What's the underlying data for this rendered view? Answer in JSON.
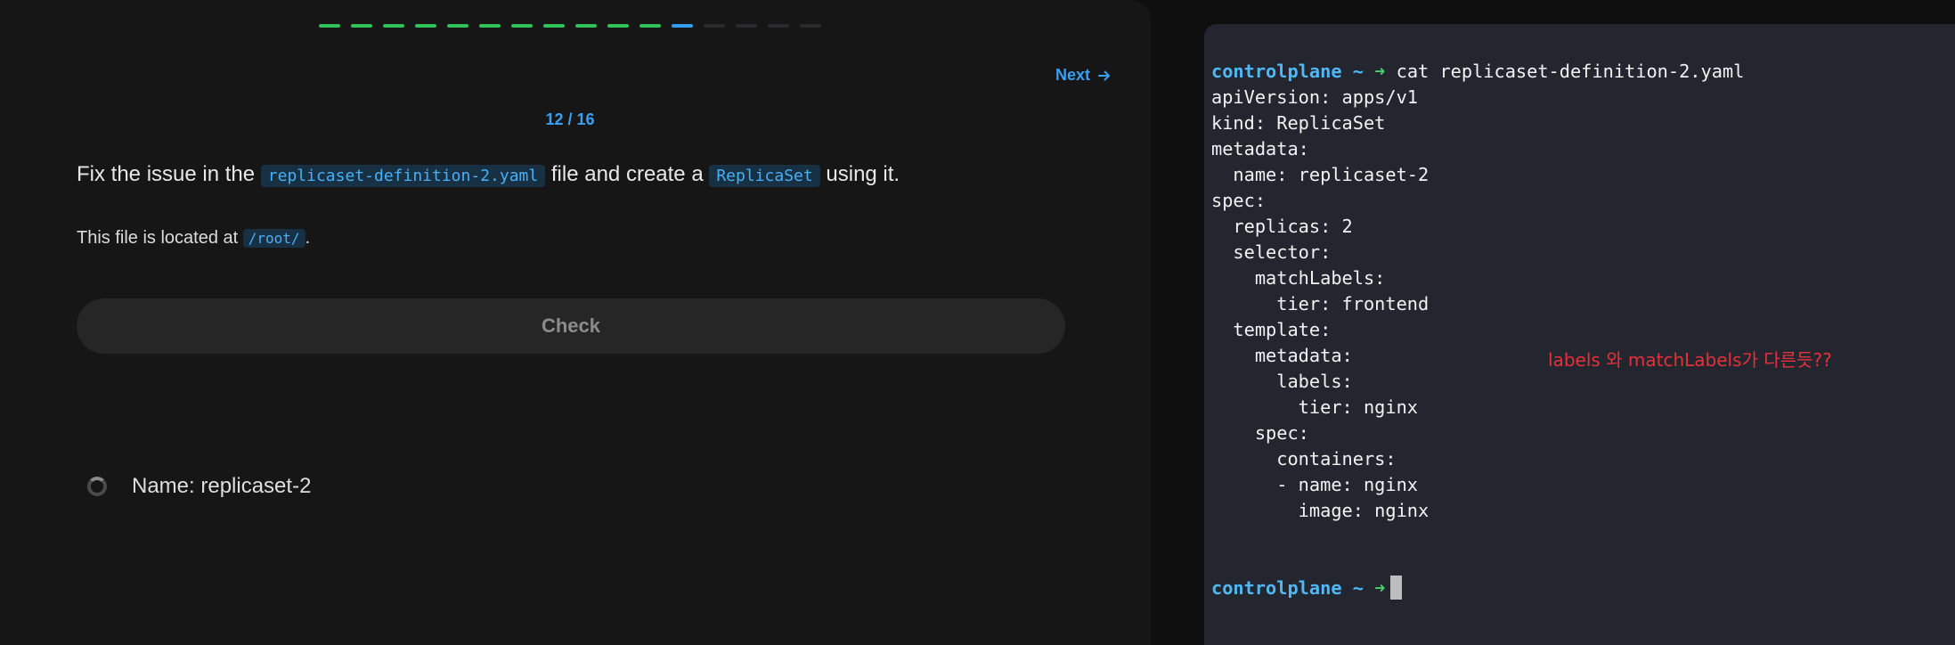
{
  "progress": {
    "total": 16,
    "current": 12,
    "colors": {
      "done": "#2fc259",
      "current": "#2f9ef0",
      "todo": "#2a2a2c"
    }
  },
  "nav": {
    "next_label": "Next",
    "next_icon": "arrow-right-icon"
  },
  "counter": "12 / 16",
  "task": {
    "prefix": "Fix the issue in the",
    "file": "replicaset-definition-2.yaml",
    "middle": "file and create a",
    "resource": "ReplicaSet",
    "suffix": "using it."
  },
  "note": {
    "prefix": "This file is located at",
    "path": "/root/",
    "suffix": "."
  },
  "check_label": "Check",
  "result_item": {
    "label": "Name: replicaset-2",
    "status_icon": "spinner-icon"
  },
  "terminal": {
    "prompt_host": "controlplane ~",
    "prompt_arrow": "➜",
    "command": "cat replicaset-definition-2.yaml",
    "output": [
      "apiVersion: apps/v1",
      "kind: ReplicaSet",
      "metadata:",
      "  name: replicaset-2",
      "spec:",
      "  replicas: 2",
      "  selector:",
      "    matchLabels:",
      "      tier: frontend",
      "  template:",
      "    metadata:",
      "      labels:",
      "        tier: nginx",
      "    spec:",
      "      containers:",
      "      - name: nginx",
      "        image: nginx"
    ]
  },
  "annotation": "labels 와 matchLabels가 다른듯??"
}
